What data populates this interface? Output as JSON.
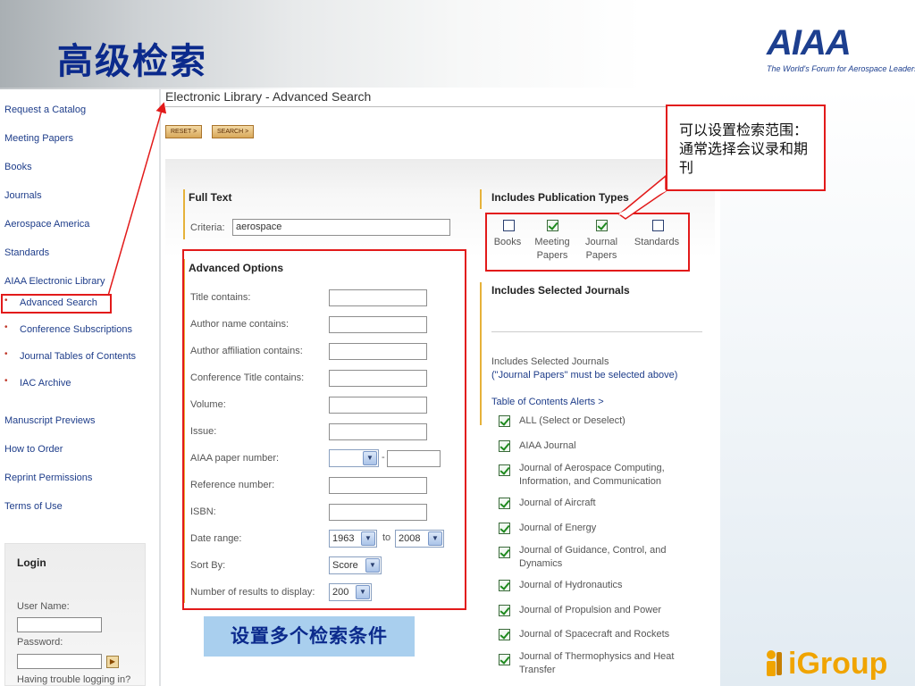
{
  "slide": {
    "title": "高级检索",
    "logo_text": "AIAA",
    "logo_tagline": "The World's Forum for Aerospace Leadership",
    "footer_logo_text": "iGroup"
  },
  "nav": {
    "items": [
      {
        "label": "Request a Catalog"
      },
      {
        "label": "Meeting Papers"
      },
      {
        "label": "Books"
      },
      {
        "label": "Journals"
      },
      {
        "label": "Aerospace America"
      },
      {
        "label": "Standards"
      },
      {
        "label": "AIAA Electronic Library"
      },
      {
        "label": "Advanced Search"
      },
      {
        "label": "Conference Subscriptions"
      },
      {
        "label": "Journal Tables of Contents"
      },
      {
        "label": "IAC Archive"
      },
      {
        "label": "Manuscript Previews"
      },
      {
        "label": "How to Order"
      },
      {
        "label": "Reprint Permissions"
      },
      {
        "label": "Terms of Use"
      }
    ]
  },
  "login": {
    "title": "Login",
    "username_label": "User Name:",
    "password_label": "Password:",
    "go_glyph": "▶",
    "trouble_text": "Having trouble logging in?"
  },
  "main": {
    "heading": "Electronic Library - Advanced Search",
    "reset_label": "RESET >",
    "search_label": "SEARCH >"
  },
  "full_text": {
    "title": "Full Text",
    "criteria_label": "Criteria:",
    "criteria_value": "aerospace"
  },
  "advanced": {
    "title": "Advanced Options",
    "fields": [
      {
        "label": "Title contains:",
        "value": ""
      },
      {
        "label": "Author name contains:",
        "value": ""
      },
      {
        "label": "Author affiliation contains:",
        "value": ""
      },
      {
        "label": "Conference Title contains:",
        "value": ""
      },
      {
        "label": "Volume:",
        "value": ""
      },
      {
        "label": "Issue:",
        "value": ""
      }
    ],
    "paper_number_label": "AIAA paper number:",
    "paper_number_dash": "-",
    "reference_label": "Reference number:",
    "isbn_label": "ISBN:",
    "date_range_label": "Date range:",
    "date_from": "1963",
    "date_to_word": "to",
    "date_to": "2008",
    "sort_label": "Sort By:",
    "sort_value": "Score",
    "results_label": "Number of results to display:",
    "results_value": "200"
  },
  "pub_types": {
    "title": "Includes Publication Types",
    "items": [
      {
        "line1": "Books",
        "line2": "",
        "checked": false
      },
      {
        "line1": "Meeting",
        "line2": "Papers",
        "checked": true
      },
      {
        "line1": "Journal",
        "line2": "Papers",
        "checked": true
      },
      {
        "line1": "Standards",
        "line2": "",
        "checked": false
      }
    ]
  },
  "journals": {
    "title": "Includes Selected Journals",
    "note_line1": "Includes Selected Journals",
    "note_line2": "(\"Journal Papers\" must be selected above)",
    "toc_alerts": "Table of Contents Alerts >",
    "items": [
      {
        "line1": "ALL (Select or Deselect)",
        "line2": ""
      },
      {
        "line1": "AIAA Journal",
        "line2": ""
      },
      {
        "line1": "Journal of Aerospace Computing,",
        "line2": "Information, and Communication"
      },
      {
        "line1": "Journal of Aircraft",
        "line2": ""
      },
      {
        "line1": "Journal of Energy",
        "line2": ""
      },
      {
        "line1": "Journal of Guidance, Control, and",
        "line2": "Dynamics"
      },
      {
        "line1": "Journal of Hydronautics",
        "line2": ""
      },
      {
        "line1": "Journal of Propulsion and Power",
        "line2": ""
      },
      {
        "line1": "Journal of Spacecraft and Rockets",
        "line2": ""
      },
      {
        "line1": "Journal of Thermophysics and Heat",
        "line2": "Transfer"
      }
    ]
  },
  "callouts": {
    "scope_note": "可以设置检索范围：通常选择会议录和期刊",
    "conditions_note": "设置多个检索条件"
  },
  "colors": {
    "title_blue": "#0b2a8c",
    "annotation_red": "#e21a1a",
    "link_blue": "#1e3d8a",
    "section_bar_gold": "#e6b23a",
    "callout_fill": "#a9cfee",
    "igroup_orange": "#f0a400"
  }
}
